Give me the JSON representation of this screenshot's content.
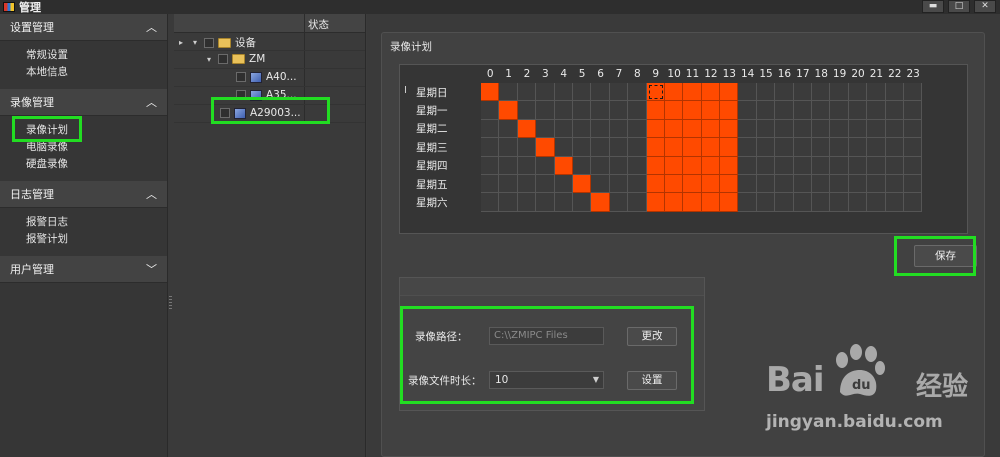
{
  "window": {
    "title": "管理"
  },
  "sidebar": {
    "sections": [
      {
        "title": "设置管理",
        "expanded": true,
        "items": [
          "常规设置",
          "本地信息"
        ]
      },
      {
        "title": "录像管理",
        "expanded": true,
        "items": [
          "录像计划",
          "电脑录像",
          "硬盘录像"
        ]
      },
      {
        "title": "日志管理",
        "expanded": true,
        "items": [
          "报警日志",
          "报警计划"
        ]
      },
      {
        "title": "用户管理",
        "expanded": false,
        "items": []
      }
    ]
  },
  "tree": {
    "status_header": "状态",
    "root": "设备",
    "group": "ZM",
    "devices": [
      "A40...",
      "A35...",
      "A29003..."
    ]
  },
  "schedule": {
    "title": "录像计划",
    "hours": [
      "0",
      "1",
      "2",
      "3",
      "4",
      "5",
      "6",
      "7",
      "8",
      "9",
      "10",
      "11",
      "12",
      "13",
      "14",
      "15",
      "16",
      "17",
      "18",
      "19",
      "20",
      "21",
      "22",
      "23"
    ],
    "days": [
      "星期日",
      "星期一",
      "星期二",
      "星期三",
      "星期四",
      "星期五",
      "星期六"
    ],
    "active_hours": [
      [
        0,
        9,
        10,
        11,
        12,
        13
      ],
      [
        1,
        9,
        10,
        11,
        12,
        13
      ],
      [
        2,
        9,
        10,
        11,
        12,
        13
      ],
      [
        3,
        9,
        10,
        11,
        12,
        13
      ],
      [
        4,
        9,
        10,
        11,
        12,
        13
      ],
      [
        5,
        9,
        10,
        11,
        12,
        13
      ],
      [
        6,
        9,
        10,
        11,
        12,
        13
      ]
    ],
    "active_color": "#ff4a00",
    "save_label": "保存"
  },
  "settings": {
    "path_label": "录像路径：",
    "path_value": "C:\\\\ZMIPC Files",
    "change_label": "更改",
    "duration_label": "录像文件时长：",
    "duration_value": "10",
    "set_label": "设置"
  },
  "watermark": {
    "brand": "Bai",
    "brand_cn": "经验",
    "url": "jingyan.baidu.com"
  }
}
